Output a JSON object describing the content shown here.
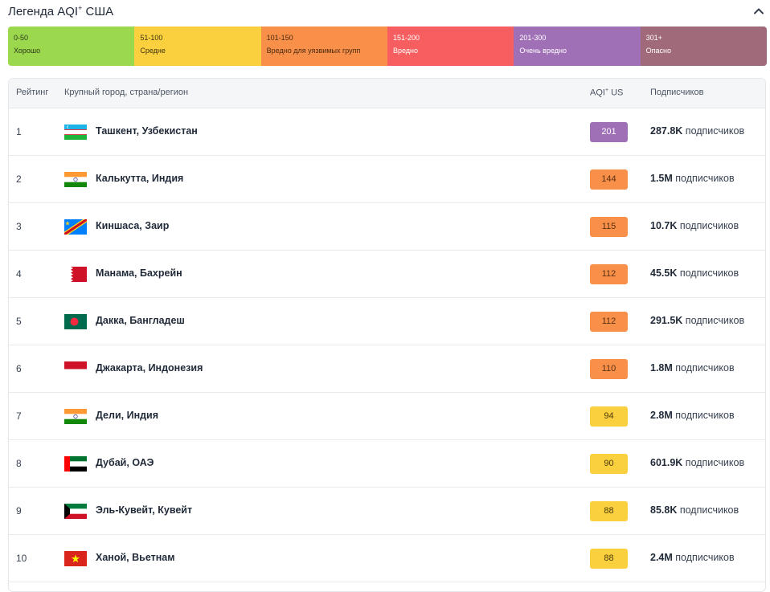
{
  "header": {
    "title_prefix": "Легенда AQI",
    "title_sup": "+",
    "title_suffix": " США"
  },
  "legend": [
    {
      "range": "0-50",
      "label": "Хорошо",
      "color": "#9cd84e",
      "text_color": "#2b3a1a"
    },
    {
      "range": "51-100",
      "label": "Средне",
      "color": "#fbd03f",
      "text_color": "#3d3410"
    },
    {
      "range": "101-150",
      "label": "Вредно для уязвимых групп",
      "color": "#f99049",
      "text_color": "#4a2a12"
    },
    {
      "range": "151-200",
      "label": "Вредно",
      "color": "#f65e5f",
      "text_color": "#ffffff"
    },
    {
      "range": "201-300",
      "label": "Очень вредно",
      "color": "#a070b6",
      "text_color": "#ffffff"
    },
    {
      "range": "301+",
      "label": "Опасно",
      "color": "#a06a7b",
      "text_color": "#ffffff"
    }
  ],
  "table": {
    "headers": {
      "rank": "Рейтинг",
      "city": "Крупный город, страна/регион",
      "aqi_prefix": "AQI",
      "aqi_sup": "+",
      "aqi_suffix": " US",
      "followers": "Подписчиков"
    },
    "rows": [
      {
        "rank": "1",
        "city": "Ташкент, Узбекистан",
        "flag": "uzbekistan-flag",
        "aqi": "201",
        "aqi_color": "#a070b6",
        "aqi_text": "#ffffff",
        "followers_num": "287.8K",
        "followers_word": "подписчиков"
      },
      {
        "rank": "2",
        "city": "Калькутта, Индия",
        "flag": "india-flag",
        "aqi": "144",
        "aqi_color": "#f99049",
        "aqi_text": "#5a2f10",
        "followers_num": "1.5M",
        "followers_word": "подписчиков"
      },
      {
        "rank": "3",
        "city": "Киншаса, Заир",
        "flag": "dr-congo-flag",
        "aqi": "115",
        "aqi_color": "#f99049",
        "aqi_text": "#5a2f10",
        "followers_num": "10.7K",
        "followers_word": "подписчиков"
      },
      {
        "rank": "4",
        "city": "Манама, Бахрейн",
        "flag": "bahrain-flag",
        "aqi": "112",
        "aqi_color": "#f99049",
        "aqi_text": "#5a2f10",
        "followers_num": "45.5K",
        "followers_word": "подписчиков"
      },
      {
        "rank": "5",
        "city": "Дакка, Бангладеш",
        "flag": "bangladesh-flag",
        "aqi": "112",
        "aqi_color": "#f99049",
        "aqi_text": "#5a2f10",
        "followers_num": "291.5K",
        "followers_word": "подписчиков"
      },
      {
        "rank": "6",
        "city": "Джакарта, Индонезия",
        "flag": "indonesia-flag",
        "aqi": "110",
        "aqi_color": "#f99049",
        "aqi_text": "#5a2f10",
        "followers_num": "1.8M",
        "followers_word": "подписчиков"
      },
      {
        "rank": "7",
        "city": "Дели, Индия",
        "flag": "india-flag",
        "aqi": "94",
        "aqi_color": "#fbd03f",
        "aqi_text": "#4a3c0a",
        "followers_num": "2.8M",
        "followers_word": "подписчиков"
      },
      {
        "rank": "8",
        "city": "Дубай, ОАЭ",
        "flag": "uae-flag",
        "aqi": "90",
        "aqi_color": "#fbd03f",
        "aqi_text": "#4a3c0a",
        "followers_num": "601.9K",
        "followers_word": "подписчиков"
      },
      {
        "rank": "9",
        "city": "Эль-Кувейт, Кувейт",
        "flag": "kuwait-flag",
        "aqi": "88",
        "aqi_color": "#fbd03f",
        "aqi_text": "#4a3c0a",
        "followers_num": "85.8K",
        "followers_word": "подписчиков"
      },
      {
        "rank": "10",
        "city": "Ханой, Вьетнам",
        "flag": "vietnam-flag",
        "aqi": "88",
        "aqi_color": "#fbd03f",
        "aqi_text": "#4a3c0a",
        "followers_num": "2.4M",
        "followers_word": "подписчиков"
      }
    ]
  }
}
